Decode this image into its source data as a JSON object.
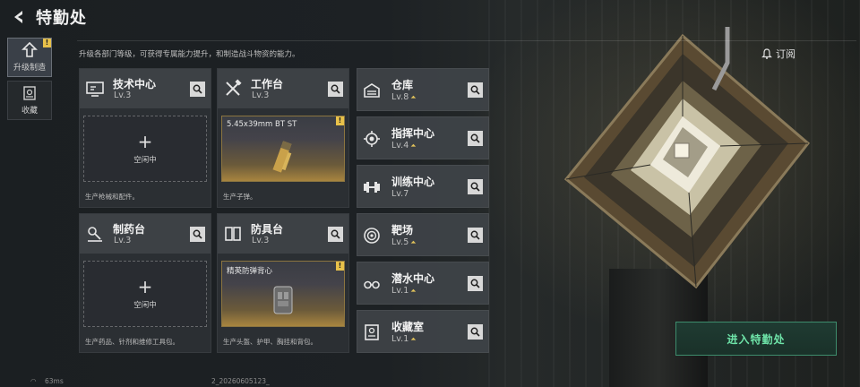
{
  "header": {
    "title": "特勤处"
  },
  "sidebar": {
    "tabs": [
      {
        "label": "升级制造",
        "badge": "!"
      },
      {
        "label": "收藏"
      }
    ]
  },
  "subtitle": "升级各部门等级，可获得专属能力提升，和制造战斗物资的能力。",
  "big_cards": [
    {
      "name": "技术中心",
      "level": "Lv.3",
      "slot": {
        "type": "idle",
        "plus": "+",
        "text": "空闲中"
      },
      "desc": "生产枪械和配件。",
      "icon": "monitor-icon"
    },
    {
      "name": "工作台",
      "level": "Lv.3",
      "slot": {
        "type": "item",
        "item_name": "5.45x39mm BT ST",
        "badge": "!"
      },
      "desc": "生产子弹。",
      "icon": "hammer-wrench-icon"
    },
    {
      "name": "制药台",
      "level": "Lv.3",
      "slot": {
        "type": "idle",
        "plus": "+",
        "text": "空闲中"
      },
      "desc": "生产药品、针剂和维修工具包。",
      "icon": "microscope-icon"
    },
    {
      "name": "防具台",
      "level": "Lv.3",
      "slot": {
        "type": "item",
        "item_name": "精英防弹背心",
        "badge": "!"
      },
      "desc": "生产头盔、护甲、胸挂和背包。",
      "icon": "armor-icon"
    }
  ],
  "small_cards": [
    {
      "name": "仓库",
      "level": "Lv.8",
      "upgradable": true,
      "icon": "warehouse-icon"
    },
    {
      "name": "指挥中心",
      "level": "Lv.4",
      "upgradable": true,
      "icon": "gear-chip-icon"
    },
    {
      "name": "训练中心",
      "level": "Lv.7",
      "upgradable": false,
      "icon": "dumbbell-icon"
    },
    {
      "name": "靶场",
      "level": "Lv.5",
      "upgradable": true,
      "icon": "target-icon"
    },
    {
      "name": "潜水中心",
      "level": "Lv.1",
      "upgradable": true,
      "icon": "goggles-icon"
    },
    {
      "name": "收藏室",
      "level": "Lv.1",
      "upgradable": true,
      "icon": "cabinet-icon"
    }
  ],
  "right": {
    "subscribe_label": "订阅",
    "enter_label": "进入特勤处"
  },
  "status": {
    "ping": "63ms",
    "build": "2_20260605123_"
  },
  "colors": {
    "accent_green": "#6ee3a8",
    "warn_yellow": "#e8c14a",
    "upgrade_gold": "#e2c25a"
  }
}
